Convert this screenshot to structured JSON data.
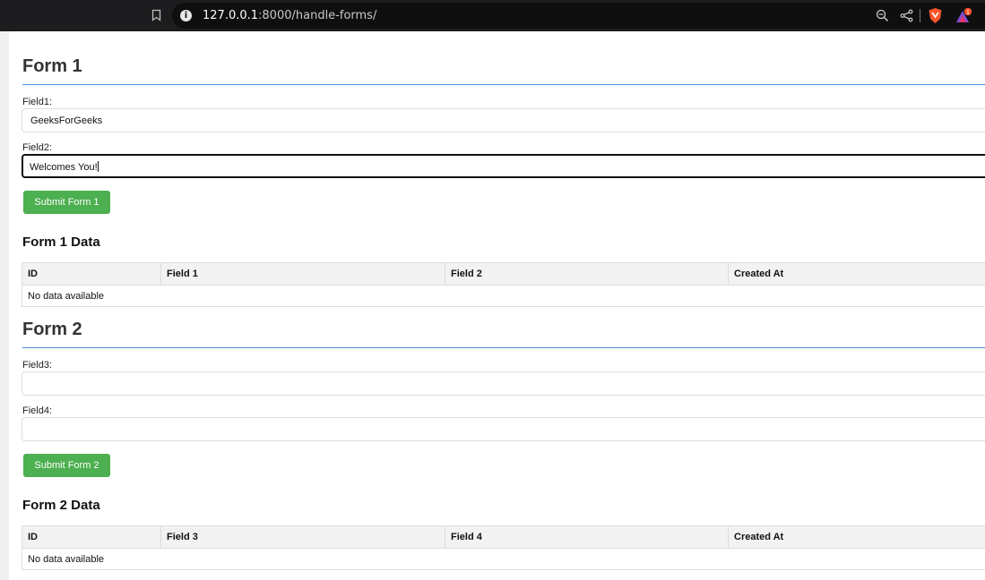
{
  "browser": {
    "url_host": "127.0.0.1",
    "url_rest": ":8000/handle-forms/",
    "rewards_badge": "1"
  },
  "form1": {
    "title": "Form 1",
    "field1_label": "Field1:",
    "field1_value": "GeeksForGeeks",
    "field2_label": "Field2:",
    "field2_value": "Welcomes You!",
    "submit_label": "Submit Form 1"
  },
  "form1_data": {
    "title": "Form 1 Data",
    "columns": [
      "ID",
      "Field 1",
      "Field 2",
      "Created At"
    ],
    "empty_text": "No data available"
  },
  "form2": {
    "title": "Form 2",
    "field3_label": "Field3:",
    "field3_value": "",
    "field4_label": "Field4:",
    "field4_value": "",
    "submit_label": "Submit Form 2"
  },
  "form2_data": {
    "title": "Form 2 Data",
    "columns": [
      "ID",
      "Field 3",
      "Field 4",
      "Created At"
    ],
    "empty_text": "No data available"
  },
  "colors": {
    "accent_rule": "#4a90d9",
    "button": "#4caf50"
  }
}
